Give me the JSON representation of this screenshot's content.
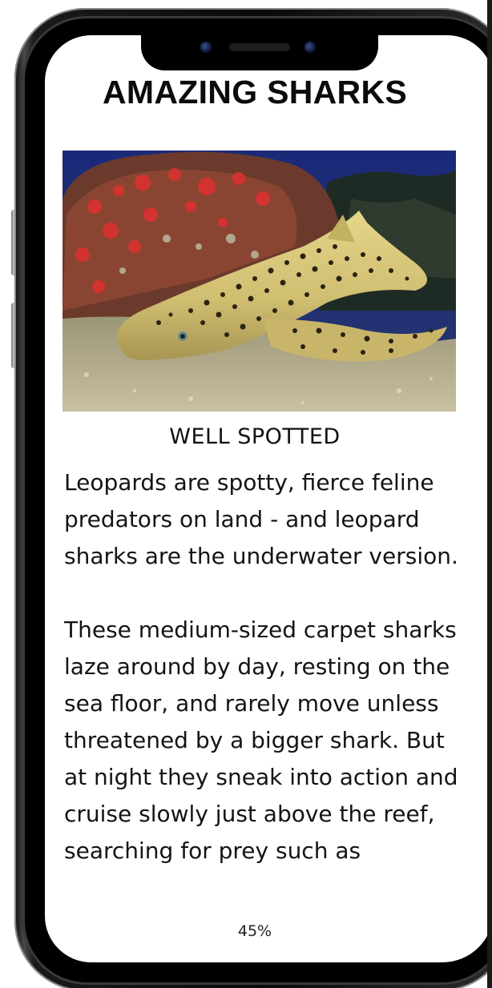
{
  "page": {
    "title": "AMAZING SHARKS",
    "subtitle": "WELL SPOTTED",
    "paragraphs": [
      "Leopards are spotty, fierce feline predators on land - and leopard sharks are the underwater version.",
      "These medium-sized carpet sharks laze around by day, resting on the sea floor, and rarely move unless threatened by a bigger shark. But at night they sneak into action and cruise slowly just above the reef, searching for prey such as"
    ],
    "progress_label": "45%",
    "progress_fraction": 0.45
  },
  "image": {
    "subject": "leopard shark resting on reef",
    "colors": {
      "water": "#1f2f7a",
      "coral": "#b8322e",
      "shark_body": "#d9c77a",
      "spots": "#2a2312",
      "sand": "#b7ad8a"
    }
  },
  "device": {
    "frame_color": "#0b0b0b",
    "screen_color": "#ffffff"
  }
}
